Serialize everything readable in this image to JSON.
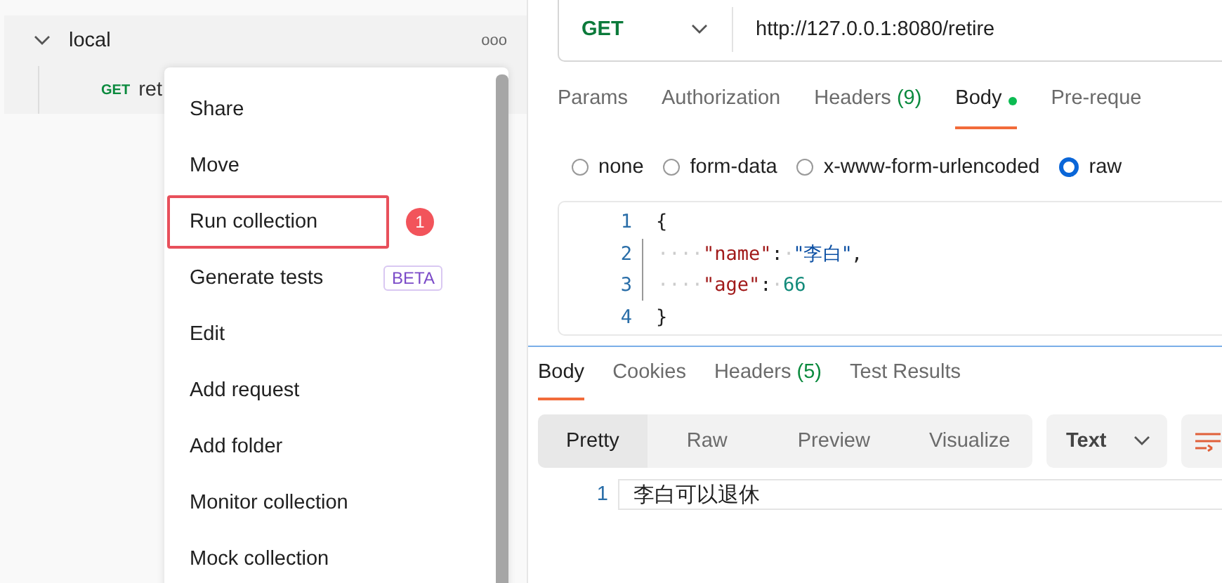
{
  "sidebar": {
    "collection": {
      "name": "local",
      "expanded": true,
      "more": "ooo",
      "requests": [
        {
          "method": "GET",
          "name": "ret"
        }
      ]
    }
  },
  "context_menu": {
    "items": [
      {
        "label": "Share",
        "highlighted": false
      },
      {
        "label": "Move",
        "highlighted": false
      },
      {
        "label": "Run collection",
        "highlighted": true,
        "annotation": "1"
      },
      {
        "label": "Generate tests",
        "highlighted": false,
        "badge": "BETA"
      },
      {
        "label": "Edit",
        "highlighted": false
      },
      {
        "label": "Add request",
        "highlighted": false
      },
      {
        "label": "Add folder",
        "highlighted": false
      },
      {
        "label": "Monitor collection",
        "highlighted": false
      },
      {
        "label": "Mock collection",
        "highlighted": false
      }
    ]
  },
  "request": {
    "method": "GET",
    "url": "http://127.0.0.1:8080/retire",
    "tabs": [
      {
        "label": "Params",
        "selected": false
      },
      {
        "label": "Authorization",
        "selected": false
      },
      {
        "label": "Headers",
        "count": "(9)",
        "selected": false
      },
      {
        "label": "Body",
        "selected": true,
        "has_content": true
      },
      {
        "label": "Pre-reque",
        "selected": false
      }
    ],
    "body_types": [
      {
        "label": "none",
        "selected": false
      },
      {
        "label": "form-data",
        "selected": false
      },
      {
        "label": "x-www-form-urlencoded",
        "selected": false
      },
      {
        "label": "raw",
        "selected": true
      }
    ],
    "body_lines": [
      {
        "number": "1",
        "tokens": [
          {
            "kind": "punct",
            "text": "{"
          }
        ]
      },
      {
        "number": "2",
        "tokens": [
          {
            "kind": "space",
            "text": "····"
          },
          {
            "kind": "key",
            "text": "\"name\""
          },
          {
            "kind": "punct",
            "text": ":"
          },
          {
            "kind": "space",
            "text": "·"
          },
          {
            "kind": "string",
            "text": "\"李白\""
          },
          {
            "kind": "punct",
            "text": ","
          }
        ]
      },
      {
        "number": "3",
        "tokens": [
          {
            "kind": "space",
            "text": "····"
          },
          {
            "kind": "key",
            "text": "\"age\""
          },
          {
            "kind": "punct",
            "text": ":"
          },
          {
            "kind": "space",
            "text": "·"
          },
          {
            "kind": "number",
            "text": "66"
          }
        ]
      },
      {
        "number": "4",
        "tokens": [
          {
            "kind": "punct",
            "text": "}"
          }
        ]
      }
    ]
  },
  "response": {
    "tabs": [
      {
        "label": "Body",
        "selected": true
      },
      {
        "label": "Cookies",
        "selected": false
      },
      {
        "label": "Headers",
        "count": "(5)",
        "selected": false
      },
      {
        "label": "Test Results",
        "selected": false
      }
    ],
    "views": [
      {
        "label": "Pretty",
        "selected": true
      },
      {
        "label": "Raw",
        "selected": false
      },
      {
        "label": "Preview",
        "selected": false
      },
      {
        "label": "Visualize",
        "selected": false
      }
    ],
    "format": "Text",
    "lines": [
      {
        "number": "1",
        "text": "李白可以退休"
      }
    ]
  }
}
